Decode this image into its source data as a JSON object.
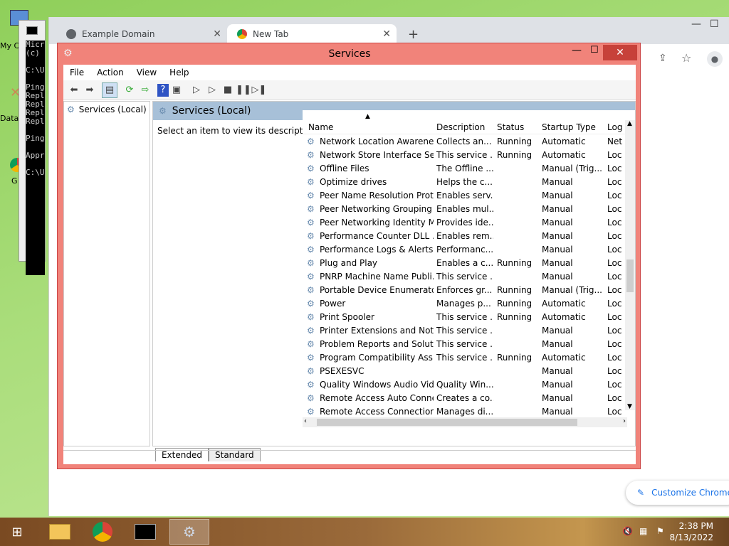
{
  "desktop": {
    "icons": [
      {
        "label": "My C"
      },
      {
        "label": "Data"
      },
      {
        "label": "G"
      }
    ]
  },
  "cmd": {
    "lines": [
      "Micr",
      "(c) ",
      "",
      "C:\\U",
      "",
      "Ping",
      "Repl",
      "Repl",
      "Repl",
      "Repl",
      "",
      "Ping",
      "",
      "Appr",
      "",
      "C:\\U"
    ]
  },
  "chrome": {
    "tabs": [
      {
        "label": "Example Domain"
      },
      {
        "label": "New Tab"
      }
    ],
    "new_tab_glyph": "+",
    "customize_label": "Customize Chrome"
  },
  "services": {
    "title": "Services",
    "menu": [
      "File",
      "Action",
      "View",
      "Help"
    ],
    "tree_root": "Services (Local)",
    "panel_title": "Services (Local)",
    "description_hint": "Select an item to view its description.",
    "columns": [
      "Name",
      "Description",
      "Status",
      "Startup Type",
      "Log"
    ],
    "rows": [
      {
        "name": "Network Location Awareness",
        "desc": "Collects an...",
        "status": "Running",
        "startup": "Automatic",
        "log": "Net"
      },
      {
        "name": "Network Store Interface Ser...",
        "desc": "This service ...",
        "status": "Running",
        "startup": "Automatic",
        "log": "Loc"
      },
      {
        "name": "Offline Files",
        "desc": "The Offline ...",
        "status": "",
        "startup": "Manual (Trig...",
        "log": "Loc"
      },
      {
        "name": "Optimize drives",
        "desc": "Helps the c...",
        "status": "",
        "startup": "Manual",
        "log": "Loc"
      },
      {
        "name": "Peer Name Resolution Prot...",
        "desc": "Enables serv...",
        "status": "",
        "startup": "Manual",
        "log": "Loc"
      },
      {
        "name": "Peer Networking Grouping",
        "desc": "Enables mul...",
        "status": "",
        "startup": "Manual",
        "log": "Loc"
      },
      {
        "name": "Peer Networking Identity M...",
        "desc": "Provides ide...",
        "status": "",
        "startup": "Manual",
        "log": "Loc"
      },
      {
        "name": "Performance Counter DLL ...",
        "desc": "Enables rem...",
        "status": "",
        "startup": "Manual",
        "log": "Loc"
      },
      {
        "name": "Performance Logs & Alerts",
        "desc": "Performanc...",
        "status": "",
        "startup": "Manual",
        "log": "Loc"
      },
      {
        "name": "Plug and Play",
        "desc": "Enables a c...",
        "status": "Running",
        "startup": "Manual",
        "log": "Loc"
      },
      {
        "name": "PNRP Machine Name Publi...",
        "desc": "This service ...",
        "status": "",
        "startup": "Manual",
        "log": "Loc"
      },
      {
        "name": "Portable Device Enumerator...",
        "desc": "Enforces gr...",
        "status": "Running",
        "startup": "Manual (Trig...",
        "log": "Loc"
      },
      {
        "name": "Power",
        "desc": "Manages p...",
        "status": "Running",
        "startup": "Automatic",
        "log": "Loc"
      },
      {
        "name": "Print Spooler",
        "desc": "This service ...",
        "status": "Running",
        "startup": "Automatic",
        "log": "Loc"
      },
      {
        "name": "Printer Extensions and Notif...",
        "desc": "This service ...",
        "status": "",
        "startup": "Manual",
        "log": "Loc"
      },
      {
        "name": "Problem Reports and Soluti...",
        "desc": "This service ...",
        "status": "",
        "startup": "Manual",
        "log": "Loc"
      },
      {
        "name": "Program Compatibility Assi...",
        "desc": "This service ...",
        "status": "Running",
        "startup": "Automatic",
        "log": "Loc"
      },
      {
        "name": "PSEXESVC",
        "desc": "",
        "status": "",
        "startup": "Manual",
        "log": "Loc"
      },
      {
        "name": "Quality Windows Audio Vid...",
        "desc": "Quality Win...",
        "status": "",
        "startup": "Manual",
        "log": "Loc"
      },
      {
        "name": "Remote Access Auto Conne...",
        "desc": "Creates a co...",
        "status": "",
        "startup": "Manual",
        "log": "Loc"
      },
      {
        "name": "Remote Access Connection...",
        "desc": "Manages di...",
        "status": "",
        "startup": "Manual",
        "log": "Loc"
      }
    ],
    "view_tabs": [
      "Extended",
      "Standard"
    ]
  },
  "taskbar": {
    "time": "2:38 PM",
    "date": "8/13/2022"
  },
  "colors": {
    "services_frame": "#f1837a",
    "panel_header": "#a7c0d8",
    "taskbar": "#8a5a2e"
  }
}
